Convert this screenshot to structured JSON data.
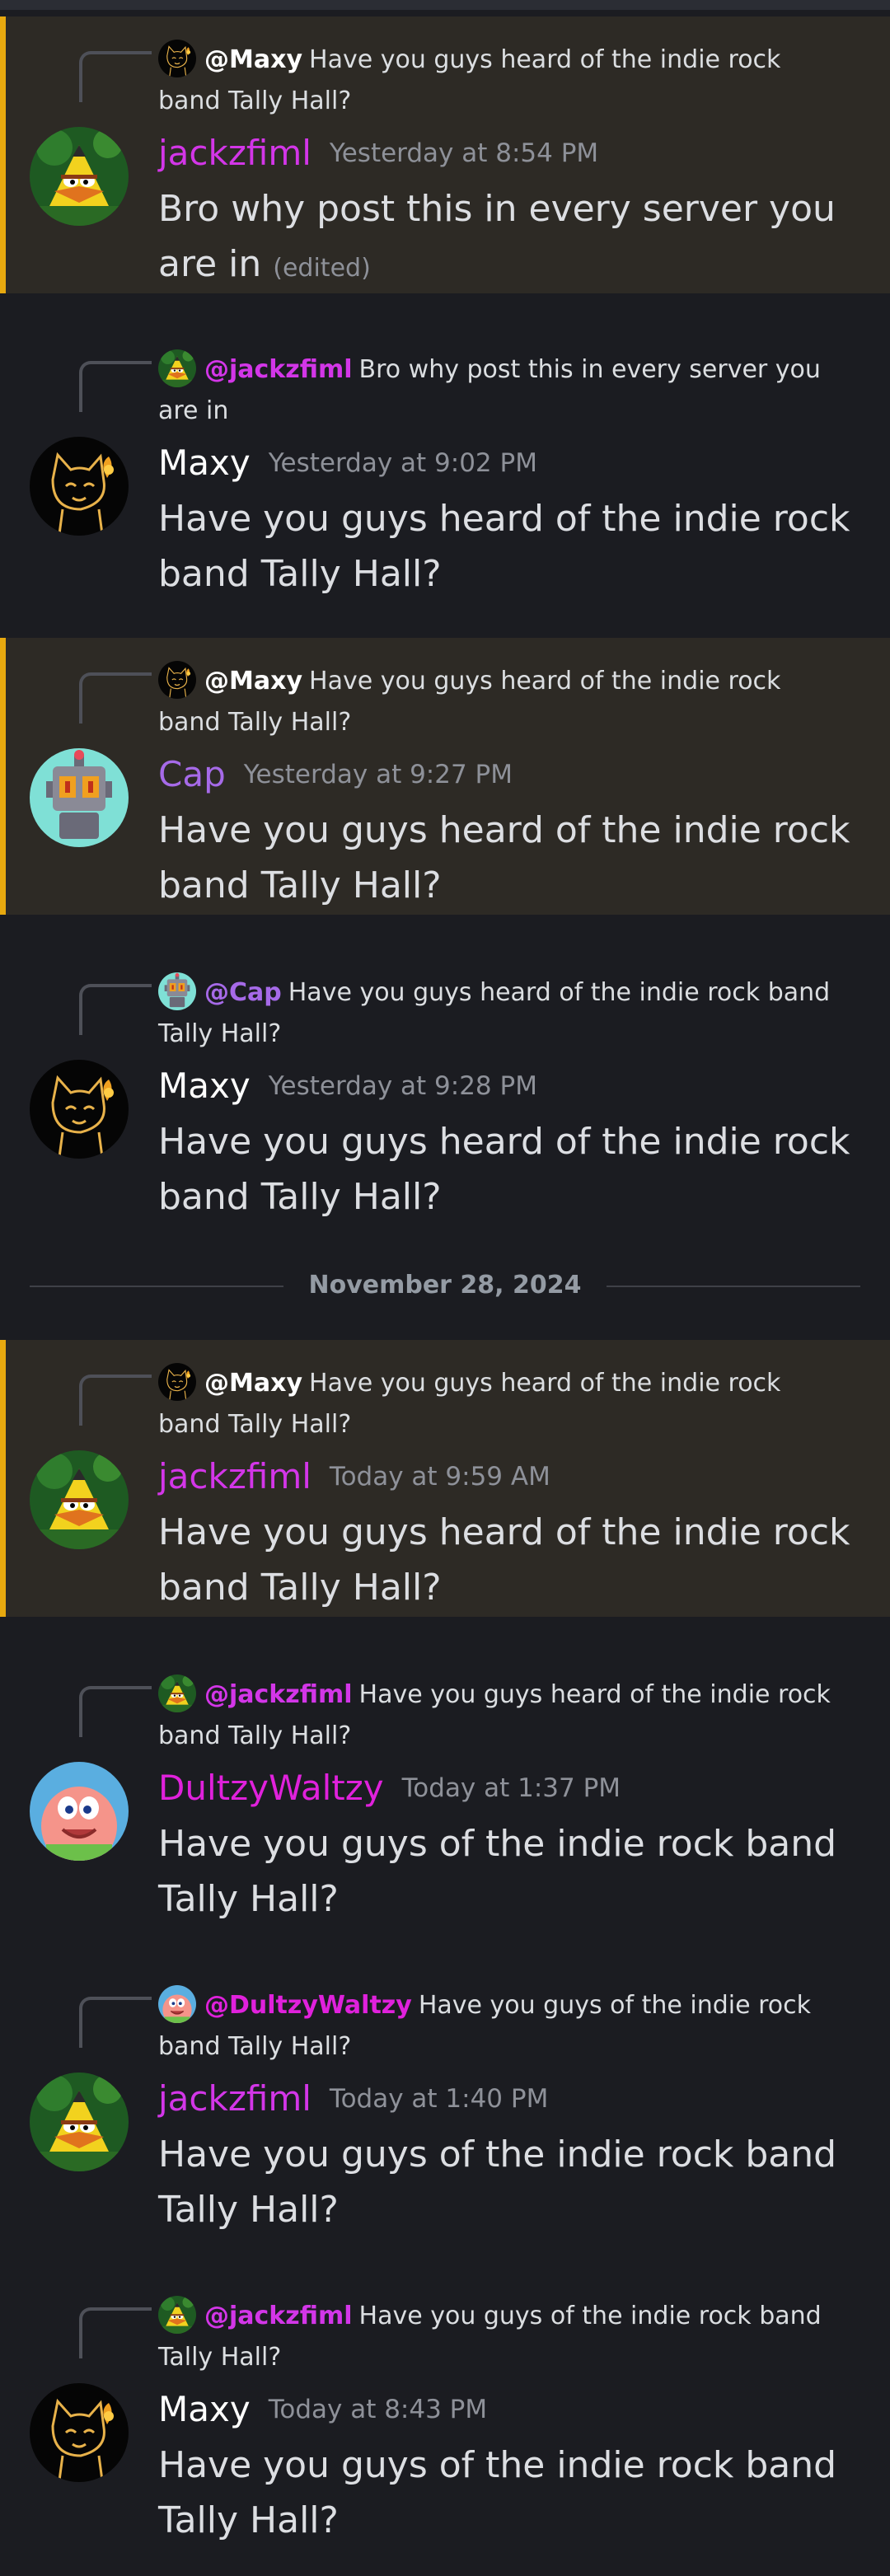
{
  "date_divider": "November 28, 2024",
  "colors": {
    "highlight_bg": "#2d2a25",
    "highlight_bar": "#e8a90f",
    "background": "#1b1c21",
    "jackzfiml": "#d336e8",
    "Maxy": "#ffffff",
    "Cap": "#a66ae8",
    "DultzyWaltzy": "#e021dc"
  },
  "messages": [
    {
      "highlighted": true,
      "avatar_icon": "bird-avatar-icon",
      "reply": {
        "mini_icon": "cat-mini-icon",
        "mention": "@Maxy",
        "text": "Have you guys heard of the indie rock band Tally Hall?"
      },
      "author": "jackzfiml",
      "timestamp": "Yesterday at 8:54 PM",
      "text": "Bro why post this in every server you are in",
      "edited": "(edited)"
    },
    {
      "highlighted": false,
      "avatar_icon": "cat-avatar-icon",
      "reply": {
        "mini_icon": "bird-mini-icon",
        "mention": "@jackzfiml",
        "text": "Bro why post this in every server you are in"
      },
      "author": "Maxy",
      "timestamp": "Yesterday at 9:02 PM",
      "text": "Have you guys heard of the indie rock band Tally Hall?"
    },
    {
      "highlighted": true,
      "avatar_icon": "robot-avatar-icon",
      "reply": {
        "mini_icon": "cat-mini-icon",
        "mention": "@Maxy",
        "text": "Have you guys heard of the indie rock band Tally Hall?"
      },
      "author": "Cap",
      "timestamp": "Yesterday at 9:27 PM",
      "text": "Have you guys heard of the indie rock band Tally Hall?"
    },
    {
      "highlighted": false,
      "avatar_icon": "cat-avatar-icon",
      "reply": {
        "mini_icon": "robot-mini-icon",
        "mention": "@Cap",
        "text": "Have you guys heard of the indie rock band Tally Hall?"
      },
      "author": "Maxy",
      "timestamp": "Yesterday at 9:28 PM",
      "text": "Have you guys heard of the indie rock band Tally Hall?"
    },
    {
      "highlighted": true,
      "avatar_icon": "bird-avatar-icon",
      "reply": {
        "mini_icon": "cat-mini-icon",
        "mention": "@Maxy",
        "text": "Have you guys heard of the indie rock band Tally Hall?"
      },
      "author": "jackzfiml",
      "timestamp": "Today at 9:59 AM",
      "text": "Have you guys heard of the indie rock band Tally Hall?"
    },
    {
      "highlighted": false,
      "avatar_icon": "starfish-avatar-icon",
      "reply": {
        "mini_icon": "bird-mini-icon",
        "mention": "@jackzfiml",
        "text": "Have you guys heard of the indie rock band Tally Hall?"
      },
      "author": "DultzyWaltzy",
      "timestamp": "Today at 1:37 PM",
      "text": "Have you guys of the indie rock band Tally Hall?"
    },
    {
      "highlighted": false,
      "avatar_icon": "bird-avatar-icon",
      "reply": {
        "mini_icon": "starfish-mini-icon",
        "mention": "@DultzyWaltzy",
        "text": "Have you guys of the indie rock band Tally Hall?"
      },
      "author": "jackzfiml",
      "timestamp": "Today at 1:40 PM",
      "text": "Have you guys of the indie rock band Tally Hall?"
    },
    {
      "highlighted": false,
      "avatar_icon": "cat-avatar-icon",
      "reply": {
        "mini_icon": "bird-mini-icon",
        "mention": "@jackzfiml",
        "text": "Have you guys of the indie rock band Tally Hall?"
      },
      "author": "Maxy",
      "timestamp": "Today at 8:43 PM",
      "text": "Have you guys of the indie rock band Tally Hall?"
    }
  ]
}
